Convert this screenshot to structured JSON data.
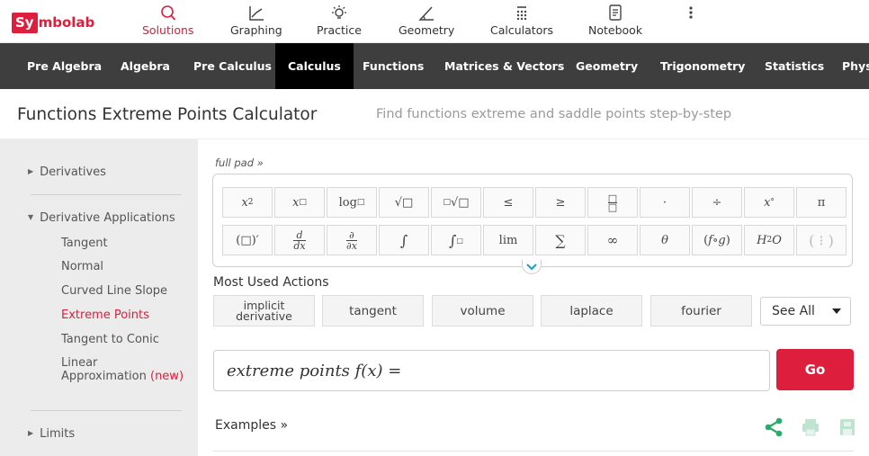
{
  "brand": {
    "logo_left": "Sy",
    "logo_right": "mbolab"
  },
  "top_nav": [
    {
      "label": "Solutions",
      "icon": "search-icon",
      "active": true
    },
    {
      "label": "Graphing",
      "icon": "graph-icon"
    },
    {
      "label": "Practice",
      "icon": "lightbulb-icon"
    },
    {
      "label": "Geometry",
      "icon": "angle-icon"
    },
    {
      "label": "Calculators",
      "icon": "calculator-icon"
    },
    {
      "label": "Notebook",
      "icon": "notebook-icon"
    },
    {
      "label": "",
      "icon": "more-vertical-icon"
    }
  ],
  "subjects": [
    "Pre Algebra",
    "Algebra",
    "Pre Calculus",
    "Calculus",
    "Functions",
    "Matrices & Vectors",
    "Geometry",
    "Trigonometry",
    "Statistics",
    "Phys"
  ],
  "active_subject": "Calculus",
  "page": {
    "title": "Functions Extreme Points Calculator",
    "subtitle": "Find functions extreme and saddle points step-by-step"
  },
  "sidebar": {
    "derivatives": "Derivatives",
    "derivative_applications": "Derivative Applications",
    "sub_items": [
      "Tangent",
      "Normal",
      "Curved Line Slope",
      "Extreme Points",
      "Tangent to Conic"
    ],
    "linear_1": "Linear",
    "linear_2": "Approximation",
    "new_tag": "(new)",
    "limits": "Limits"
  },
  "full_pad": "full pad »",
  "most_used_title": "Most Used Actions",
  "actions": {
    "implicit_1": "implicit",
    "implicit_2": "derivative",
    "tangent": "tangent",
    "volume": "volume",
    "laplace": "laplace",
    "fourier": "fourier"
  },
  "see_all": "See All",
  "input": {
    "expression": "extreme points f(x) ="
  },
  "go_label": "Go",
  "examples_label": "Examples »",
  "colors": {
    "brand_red": "#dd1e3c",
    "subject_bar": "#3e3e3e",
    "sidebar_bg": "#ececec",
    "share_green": "#2bab6c"
  }
}
